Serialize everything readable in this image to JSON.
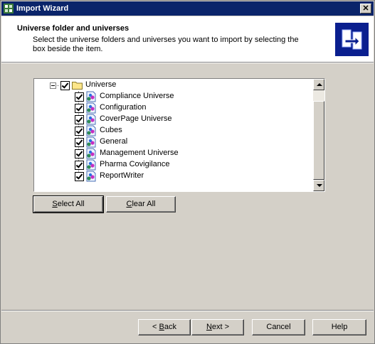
{
  "window": {
    "title": "Import Wizard",
    "close_glyph": "✕"
  },
  "header": {
    "title": "Universe folder and universes",
    "description": "Select the universe folders and universes you want to import by selecting the box beside the item."
  },
  "tree": {
    "root": {
      "label": "Universe",
      "checked": true,
      "icon": "folder-icon"
    },
    "items": [
      {
        "label": "Compliance Universe",
        "checked": true,
        "icon": "universe-icon"
      },
      {
        "label": "Configuration",
        "checked": true,
        "icon": "universe-icon"
      },
      {
        "label": "CoverPage Universe",
        "checked": true,
        "icon": "universe-icon"
      },
      {
        "label": "Cubes",
        "checked": true,
        "icon": "universe-icon"
      },
      {
        "label": "General",
        "checked": true,
        "icon": "universe-icon"
      },
      {
        "label": "Management Universe",
        "checked": true,
        "icon": "universe-icon"
      },
      {
        "label": "Pharma Covigilance",
        "checked": true,
        "icon": "universe-icon"
      },
      {
        "label": "ReportWriter",
        "checked": true,
        "icon": "universe-icon"
      }
    ]
  },
  "selection_buttons": {
    "select_all": {
      "mnemonic": "S",
      "rest": "elect All"
    },
    "clear_all": {
      "mnemonic": "C",
      "rest": "lear All"
    }
  },
  "nav_buttons": {
    "back": {
      "prefix": "< ",
      "mnemonic": "B",
      "rest": "ack"
    },
    "next": {
      "mnemonic": "N",
      "rest": "ext >"
    },
    "cancel": "Cancel",
    "help": "Help"
  },
  "colors": {
    "titlebar": "#0a246a",
    "face": "#d4d0c8",
    "header_icon_bg": "#0a1f8f"
  }
}
